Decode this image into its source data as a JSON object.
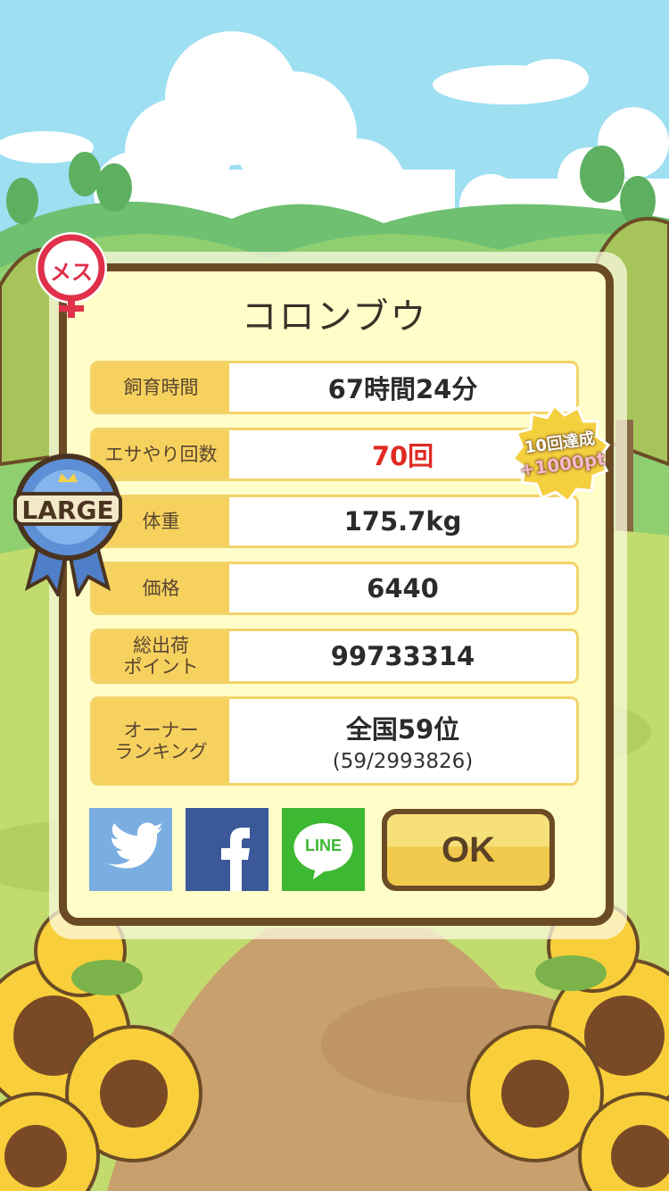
{
  "title": "コロンブウ",
  "gender_badge": "メス",
  "size_ribbon": "LARGE",
  "rows": [
    {
      "label": "飼育時間",
      "value": "67時間24分"
    },
    {
      "label": "エサやり回数",
      "value": "70回"
    },
    {
      "label": "体重",
      "value": "175.7kg"
    },
    {
      "label": "価格",
      "value": "6440"
    },
    {
      "label": "総出荷\nポイント",
      "value": "99733314"
    },
    {
      "label": "オーナー\nランキング",
      "value": "全国59位",
      "sub": "(59/2993826)"
    }
  ],
  "achievement_seal": {
    "line1": "10回達成",
    "line2": "+1000pt"
  },
  "share": {
    "line_label": "LINE"
  },
  "ok_label": "OK",
  "colors": {
    "sky": "#9edff2",
    "grass": "#b8d76a",
    "path": "#c8a06e",
    "panel_border": "#6b4b26",
    "panel_bg": "#fffdc8",
    "label_bg": "#f6d15e",
    "highlight_red": "#e02a24",
    "twitter": "#7aaee0",
    "facebook": "#3b5998",
    "line": "#3db833"
  }
}
